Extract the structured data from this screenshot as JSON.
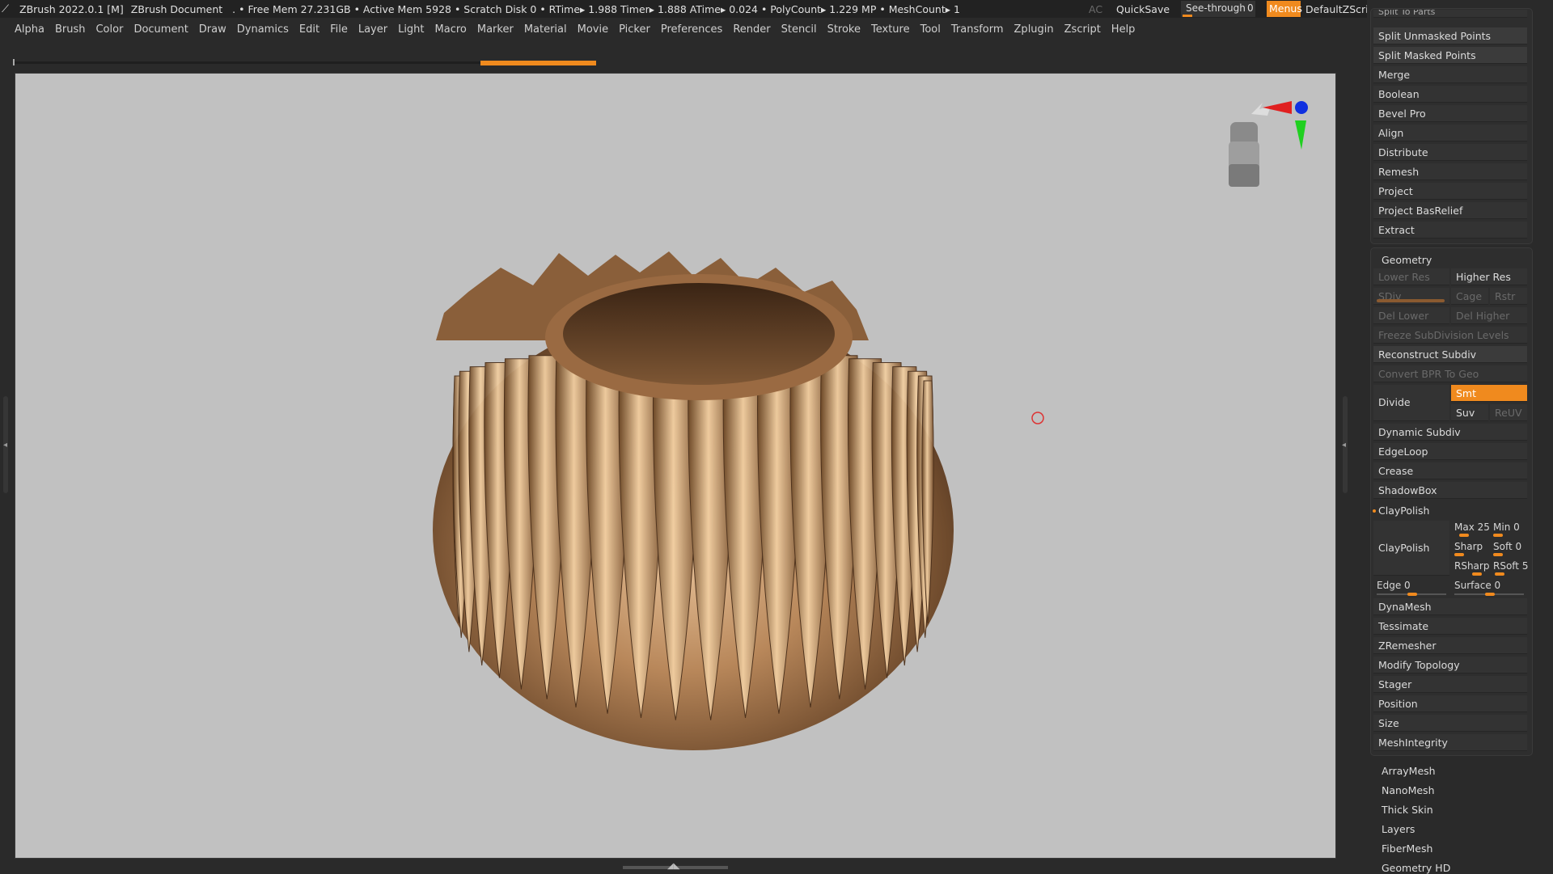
{
  "titlebar": {
    "app_title": "ZBrush 2022.0.1 [M]",
    "document": "ZBrush Document",
    "stats": ". • Free Mem 27.231GB • Active Mem 5928 • Scratch Disk 0 •  RTime▸ 1.988 Timer▸ 1.888 ATime▸ 0.024 • PolyCount▸ 1.229 MP  • MeshCount▸ 1",
    "ac": "AC",
    "quicksave": "QuickSave",
    "see_through_label": "See-through",
    "see_through_value": "0",
    "menus": "Menus",
    "default_zscript": "DefaultZScript"
  },
  "menubar": [
    "Alpha",
    "Brush",
    "Color",
    "Document",
    "Draw",
    "Dynamics",
    "Edit",
    "File",
    "Layer",
    "Light",
    "Macro",
    "Marker",
    "Material",
    "Movie",
    "Picker",
    "Preferences",
    "Render",
    "Stencil",
    "Stroke",
    "Texture",
    "Tool",
    "Transform",
    "Zplugin",
    "Zscript",
    "Help"
  ],
  "subtool_panel": {
    "top_cut": "Split To Parts",
    "items": [
      "Split Unmasked Points",
      "Split Masked Points",
      "Merge",
      "Boolean",
      "Bevel Pro",
      "Align",
      "Distribute",
      "Remesh",
      "Project",
      "Project BasRelief",
      "Extract"
    ]
  },
  "geometry": {
    "title": "Geometry",
    "lower_res": "Lower Res",
    "higher_res": "Higher Res",
    "sdiv": "SDiv",
    "cage": "Cage",
    "rstr": "Rstr",
    "del_lower": "Del Lower",
    "del_higher": "Del Higher",
    "freeze": "Freeze SubDivision Levels",
    "reconstruct": "Reconstruct Subdiv",
    "convert_bpr": "Convert BPR To Geo",
    "divide": "Divide",
    "smt": "Smt",
    "suv": "Suv",
    "reuv": "ReUV",
    "dynamic_subdiv": "Dynamic Subdiv",
    "edgeloop": "EdgeLoop",
    "crease": "Crease",
    "shadowbox": "ShadowBox",
    "claypolish_header": "ClayPolish",
    "claypolish_btn": "ClayPolish",
    "max": "Max 25",
    "min": "Min 0",
    "sharp": "Sharp",
    "soft": "Soft 0",
    "rsharp": "RSharp",
    "rsoft": "RSoft 5",
    "edge": "Edge 0",
    "surface": "Surface 0",
    "items": [
      "DynaMesh",
      "Tessimate",
      "ZRemesher",
      "Modify Topology",
      "Stager",
      "Position",
      "Size",
      "MeshIntegrity"
    ]
  },
  "tool_sections": [
    "ArrayMesh",
    "NanoMesh",
    "Thick Skin",
    "Layers",
    "FiberMesh",
    "Geometry HD"
  ],
  "colors": {
    "accent": "#f08a1e",
    "canvas": "#c1c1c1",
    "panel": "#2a2a2a",
    "bronze": "#b8875a"
  }
}
